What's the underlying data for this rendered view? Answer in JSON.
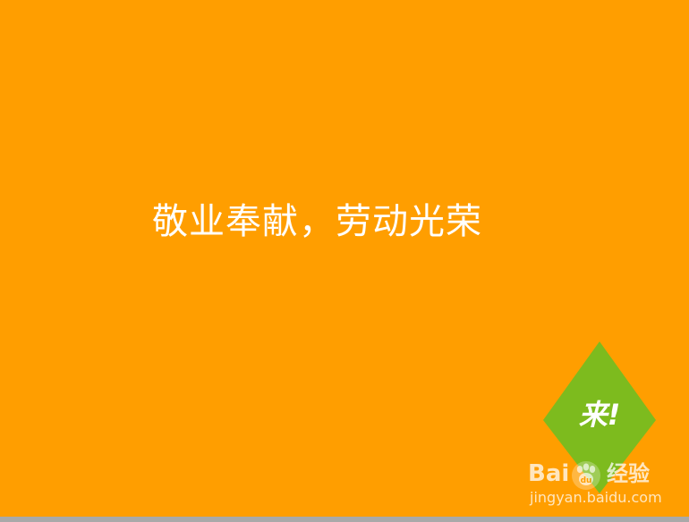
{
  "slide": {
    "headline": "敬业奉献，劳动光荣",
    "badge_label": "来!",
    "background_color": "#ff9e00",
    "badge_color": "#7dbb1e"
  },
  "watermark": {
    "brand_left": "Bai",
    "brand_right": "经验",
    "logo_icon": "paw-icon",
    "url": "jingyan.baidu.com"
  }
}
